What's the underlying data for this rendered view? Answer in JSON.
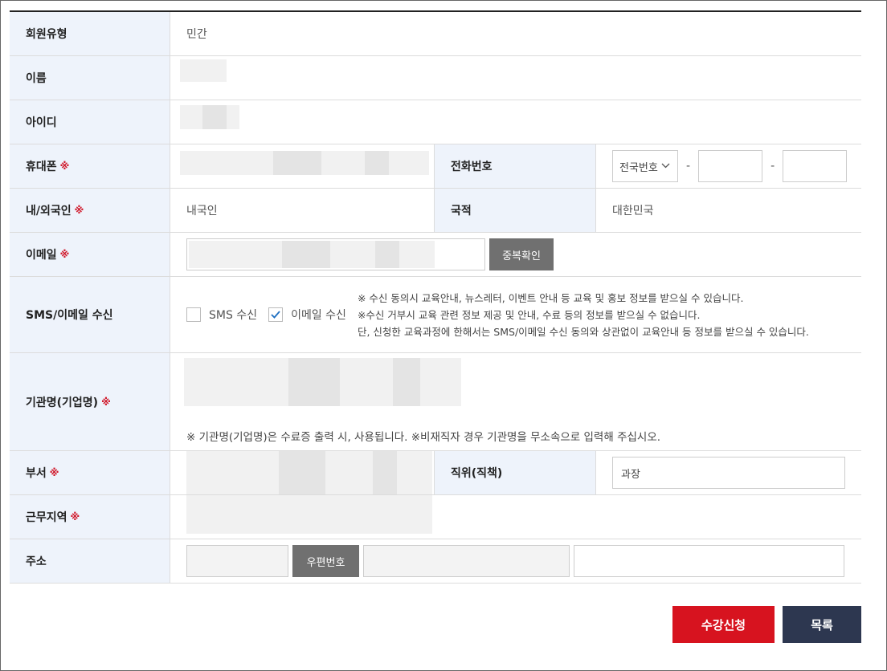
{
  "form": {
    "member_type": {
      "label": "회원유형",
      "value": "민간"
    },
    "name": {
      "label": "이름"
    },
    "user_id": {
      "label": "아이디"
    },
    "mobile": {
      "label": "휴대폰",
      "required_mark": "※"
    },
    "phone": {
      "label": "전화번호",
      "area_select": "전국번호",
      "separator": "-"
    },
    "nationality_type": {
      "label": "내/외국인",
      "required_mark": "※",
      "value": "내국인"
    },
    "nationality": {
      "label": "국적",
      "value": "대한민국"
    },
    "email": {
      "label": "이메일",
      "required_mark": "※",
      "check_button": "중복확인"
    },
    "sms_email": {
      "label": "SMS/이메일 수신",
      "sms_option": "SMS 수신",
      "sms_checked": false,
      "email_option": "이메일 수신",
      "email_checked": true,
      "notice_1": "※ 수신 동의시 교육안내, 뉴스레터, 이벤트 안내 등 교육 및 홍보 정보를 받으실 수 있습니다.",
      "notice_2": "※수신 거부시 교육 관련 정보 제공 및 안내, 수료 등의 정보를 받으실 수 없습니다.",
      "notice_3": "단, 신청한 교육과정에 한해서는 SMS/이메일 수신 동의와 상관없이 교육안내 등 정보를 받으실 수 있습니다."
    },
    "organization": {
      "label": "기관명(기업명)",
      "required_mark": "※",
      "notice": "※ 기관명(기업명)은 수료증 출력 시, 사용됩니다. ※비재직자 경우 기관명을 무소속으로 입력해 주십시오."
    },
    "department": {
      "label": "부서",
      "required_mark": "※"
    },
    "position": {
      "label": "직위(직책)",
      "value": "과장"
    },
    "work_region": {
      "label": "근무지역",
      "required_mark": "※"
    },
    "address": {
      "label": "주소",
      "postcode_button": "우편번호"
    }
  },
  "actions": {
    "apply": "수강신청",
    "list": "목록"
  },
  "colors": {
    "header_bg": "#eef3fb",
    "required": "#d0182a",
    "apply": "#d7131f",
    "list": "#2d3750",
    "gray_button": "#707070"
  }
}
